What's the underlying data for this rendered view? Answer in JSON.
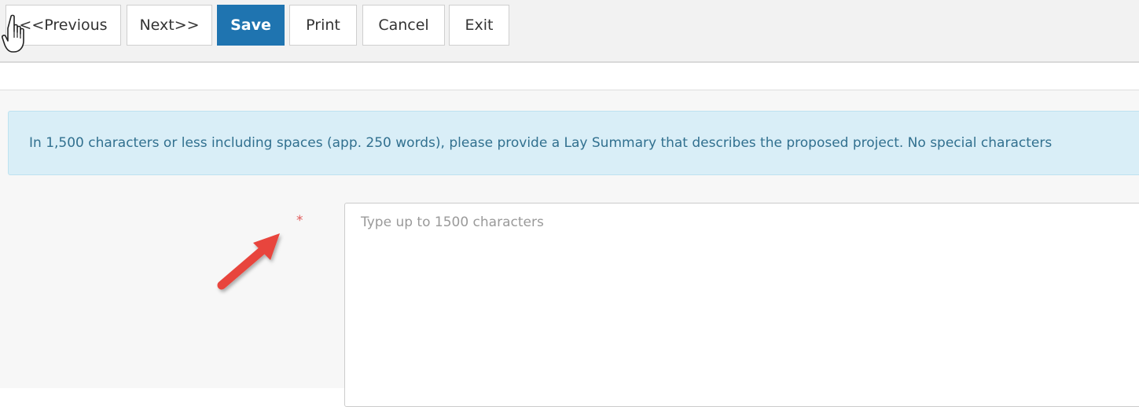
{
  "toolbar": {
    "previous_label": "<<Previous",
    "next_label": "Next>>",
    "save_label": "Save",
    "print_label": "Print",
    "cancel_label": "Cancel",
    "exit_label": "Exit"
  },
  "info_banner": {
    "text": "In 1,500 characters or less including spaces (app. 250 words), please provide a Lay Summary that describes the proposed project. No special characters"
  },
  "lay_summary": {
    "required_marker": "*",
    "placeholder": "Type up to 1500 characters",
    "value": ""
  },
  "colors": {
    "primary_button": "#1f74b0",
    "info_background": "#d9eef7",
    "info_text": "#31708f",
    "required": "#e05a5a",
    "annotation_arrow": "#e8453c"
  }
}
